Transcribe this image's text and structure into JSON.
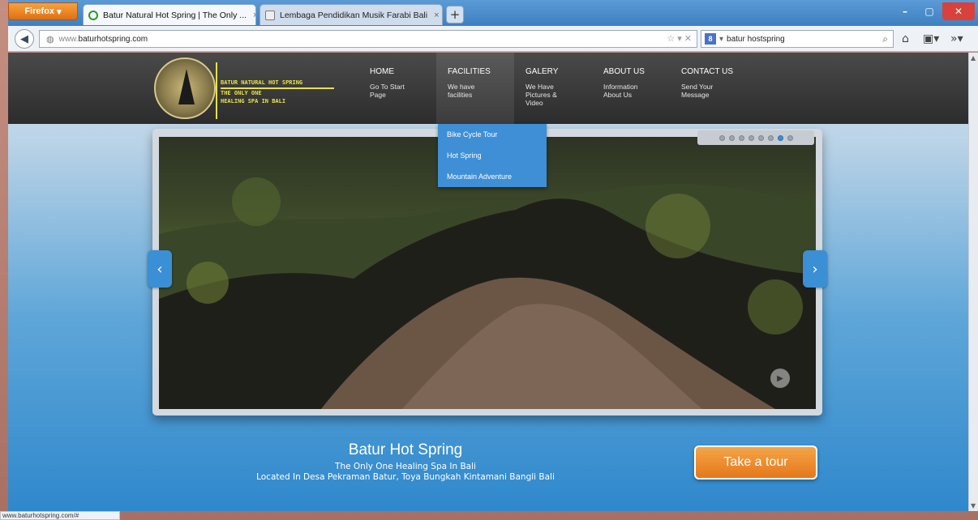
{
  "browser": {
    "menu_button": "Firefox",
    "tabs": [
      {
        "title": "Batur Natural Hot Spring | The Only ...",
        "close": "×"
      },
      {
        "title": "Lembaga Pendidikan Musik Farabi Bali",
        "close": "×"
      }
    ],
    "new_tab": "+",
    "url_prefix": "www.",
    "url_domain": "baturhotspring.com",
    "search_value": "batur hostspring",
    "search_engine_badge": "8",
    "status_url": "www.baturhotspring.com/#"
  },
  "site": {
    "logo_lines": [
      "Batur Natural Hot Spring",
      "The only one",
      "healing spa in Bali"
    ],
    "menu": [
      {
        "title": "HOME",
        "sub": "Go To Start\nPage"
      },
      {
        "title": "FACILITIES",
        "sub": "We have\nfacilities"
      },
      {
        "title": "GALERY",
        "sub": "We Have\nPictures &\nVideo"
      },
      {
        "title": "ABOUT US",
        "sub": "Information\nAbout Us"
      },
      {
        "title": "CONTACT US",
        "sub": "Send Your\nMessage"
      }
    ],
    "dropdown": [
      "Bike Cycle Tour",
      "Hot Spring",
      "Mountain Adventure"
    ],
    "caption_title": "Batur Hot Spring",
    "caption_line1": "The Only One Healing Spa In Bali",
    "caption_line2": "Located In Desa Pekraman Batur, Toya Bungkah Kintamani Bangli Bali",
    "tour_button": "Take a tour"
  }
}
